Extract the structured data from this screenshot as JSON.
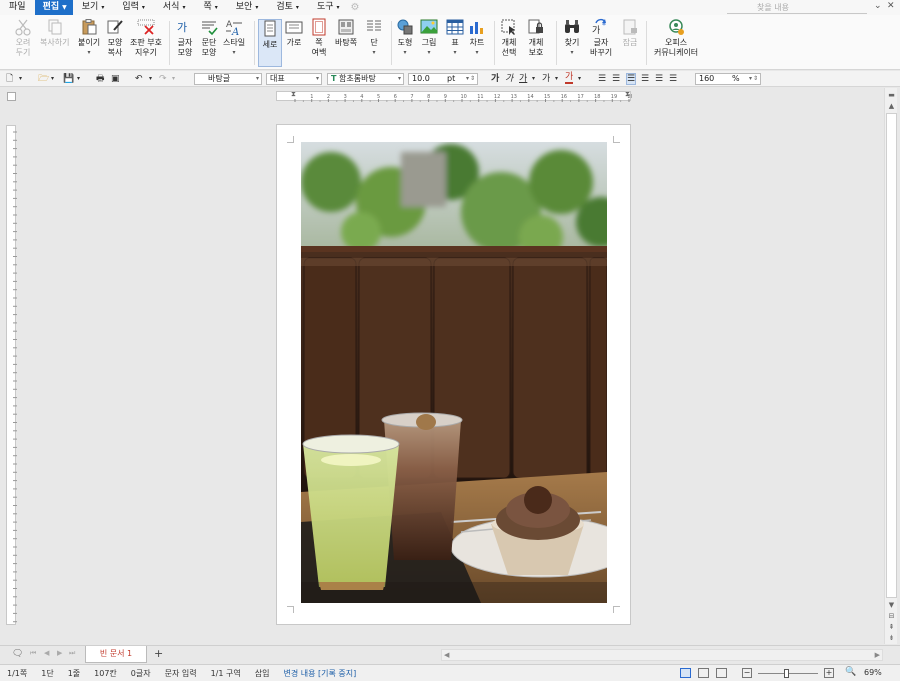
{
  "menu": {
    "items": [
      "파일",
      "편집",
      "보기",
      "입력",
      "서식",
      "쪽",
      "보안",
      "검토",
      "도구"
    ],
    "active_index": 1,
    "search_placeholder": "찾을 내용"
  },
  "ribbon": {
    "cut": "오려\n두기",
    "copy": "복사하기",
    "paste": "붙이기",
    "format_copy": "모양\n복사",
    "clear_marks": "조판 부호\n지우기",
    "char_shape": "글자\n모양",
    "para_shape": "문단\n모양",
    "style": "스타일",
    "portrait": "세로",
    "landscape": "가로",
    "page_margins": "쪽\n여백",
    "page_bg": "바탕쪽",
    "columns": "단",
    "shape": "도형",
    "picture": "그림",
    "table": "표",
    "chart": "차트",
    "select_object": "개체\n선택",
    "protect_object": "개체\n보호",
    "find": "찾기",
    "replace": "글자\n바꾸기",
    "lock": "잠금",
    "office": "오피스\n커뮤니케이터"
  },
  "format": {
    "style": "바탕글",
    "lang": "대표",
    "font": "함초롬바탕",
    "size": "10.0",
    "unit": "pt",
    "bold": "가",
    "italic": "가",
    "underline": "가",
    "strike": "가",
    "color": "가",
    "zoom": "160",
    "zoom_unit": "%"
  },
  "ruler": {
    "ticks": [
      "1",
      "2",
      "3",
      "4",
      "5",
      "6",
      "7",
      "8",
      "9",
      "10",
      "11",
      "12",
      "13",
      "14",
      "15",
      "16",
      "17",
      "18",
      "19",
      "20"
    ]
  },
  "tabs": {
    "doc_name": "빈 문서 1",
    "add": "+"
  },
  "status": {
    "page": "1/1쪽",
    "column": "1단",
    "line": "1줄",
    "col_pos": "107칸",
    "chars": "0글자",
    "input_mode": "문자 입력",
    "section": "1/1 구역",
    "insert": "삽입",
    "track": "변경 내용 [기록 중지]",
    "zoom": "69%"
  },
  "colors": {
    "accent": "#1e6fc9",
    "tab_text": "#c0392b",
    "track_text": "#1e5fa8"
  }
}
